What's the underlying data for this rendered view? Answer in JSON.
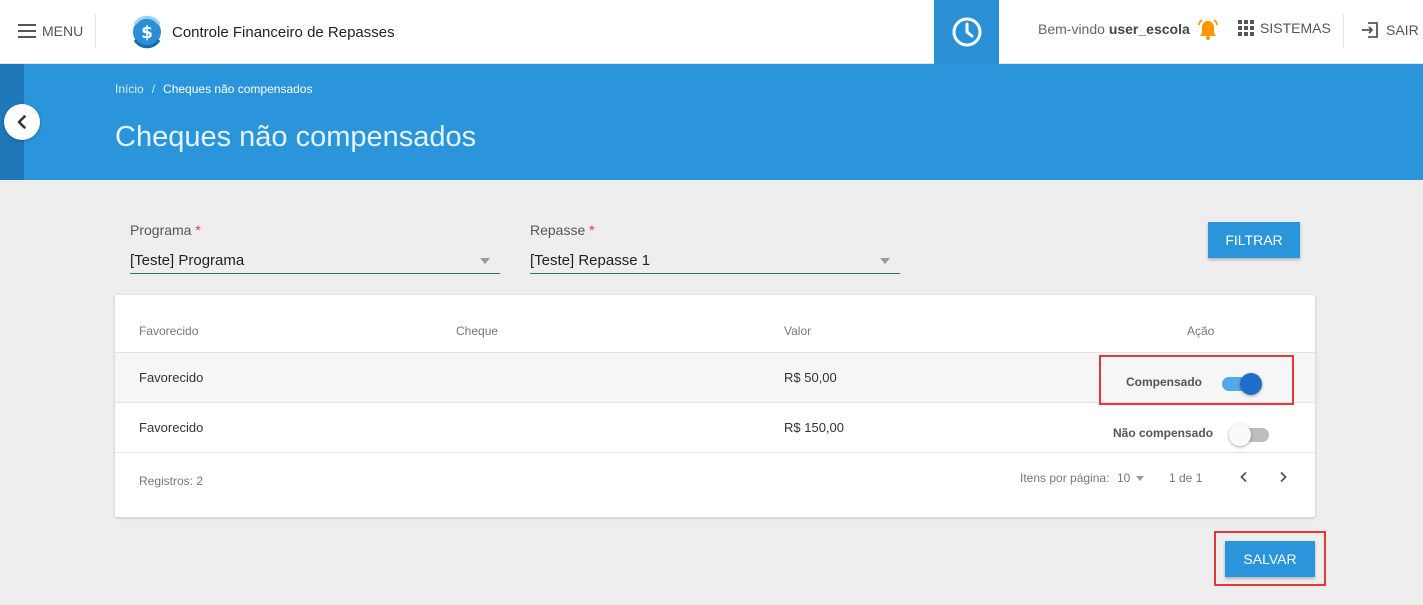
{
  "topbar": {
    "menu_label": "MENU",
    "app_title": "Controle Financeiro de Repasses",
    "welcome_prefix": "Bem-vindo",
    "username": "user_escola",
    "sistemas_label": "SISTEMAS",
    "sair_label": "SAIR"
  },
  "header": {
    "breadcrumb": [
      {
        "label": "Início"
      },
      {
        "label": "Cheques não compensados"
      }
    ],
    "breadcrumb_separator": "/",
    "title": "Cheques não compensados"
  },
  "filters": {
    "programa": {
      "label": "Programa",
      "required_mark": "*",
      "value": "[Teste] Programa"
    },
    "repasse": {
      "label": "Repasse",
      "required_mark": "*",
      "value": "[Teste] Repasse 1"
    },
    "filter_button": "FILTRAR"
  },
  "table": {
    "columns": [
      "Favorecido",
      "Cheque",
      "Valor",
      "Ação"
    ],
    "rows": [
      {
        "favorecido": "Favorecido",
        "cheque": "",
        "valor": "R$ 50,00",
        "acao_label": "Compensado",
        "compensado": true
      },
      {
        "favorecido": "Favorecido",
        "cheque": "",
        "valor": "R$ 150,00",
        "acao_label": "Não compensado",
        "compensado": false
      }
    ],
    "footer": {
      "registros": "Registros: 2",
      "items_per_page_label": "Itens por página:",
      "items_per_page_value": "10",
      "page_range": "1 de 1"
    }
  },
  "save_button": "SALVAR",
  "colors": {
    "primary": "#2b95db",
    "topbar_accent": "#2b8fd6",
    "highlight": "#e53935",
    "toggle_on": "#1e6ec9",
    "bell": "#ff9800"
  }
}
